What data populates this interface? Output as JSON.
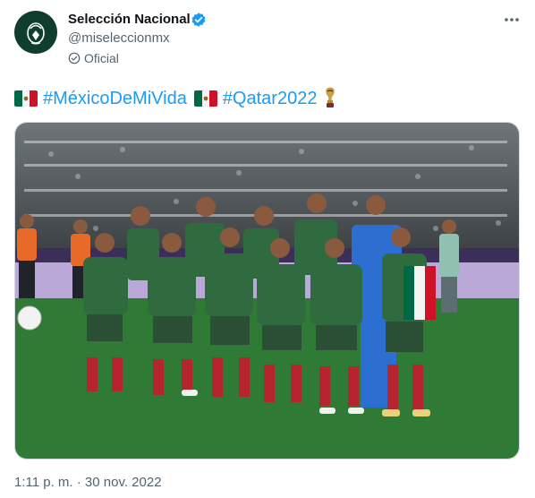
{
  "author": {
    "name": "Selección Nacional",
    "handle": "@miseleccionmx",
    "label": "Oficial",
    "avatar_icon": "mexico-crest-icon",
    "verified_icon": "verified-badge-icon",
    "official_icon": "official-check-icon"
  },
  "more_icon": "more-options-icon",
  "text": {
    "hashtag_1": "#MéxicoDeMiVida",
    "hashtag_2": "#Qatar2022",
    "flag_icon": "mexico-flag-icon",
    "trophy_icon": "world-cup-trophy-icon"
  },
  "media": {
    "description_icon": "team-photo"
  },
  "meta": {
    "timestamp": "1:11 p. m. · 30 nov. 2022"
  },
  "colors": {
    "link": "#1d9bf0",
    "secondary_text": "#536471",
    "verified": "#1d9bf0",
    "kit_green": "#2f6b3f",
    "kit_red": "#b5242f",
    "pitch": "#2f7a35"
  }
}
